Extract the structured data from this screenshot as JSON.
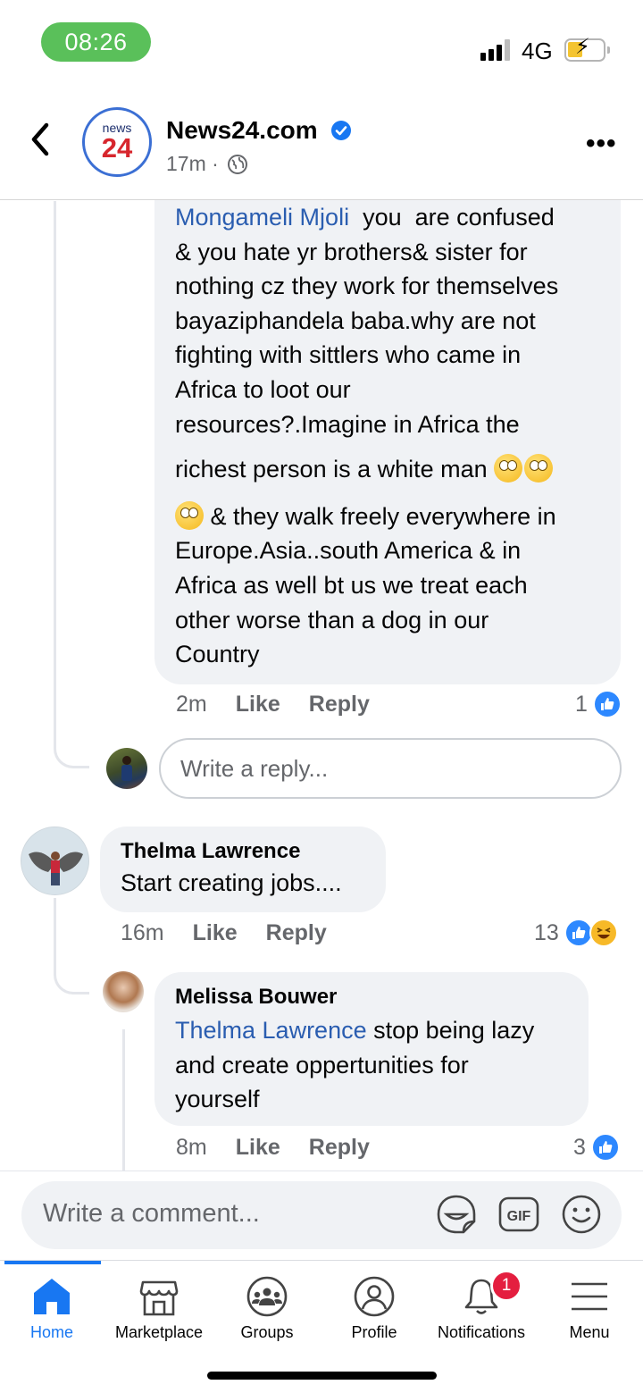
{
  "status_bar": {
    "time": "08:26",
    "network": "4G"
  },
  "post_header": {
    "logo_top": "news",
    "logo_bottom": "24",
    "page_name": "News24.com",
    "time": "17m ·"
  },
  "comments": {
    "reply1": {
      "mention": "Mongameli Mjoli",
      "lines": [
        "  you  are confused",
        "& you hate yr brothers& sister for",
        "nothing cz they work for themselves",
        "bayaziphandela baba.why are not",
        "fighting with sittlers who came in",
        "Africa to loot our",
        "resources?.Imagine in Africa the",
        "richest person is a white man",
        " & they walk freely everywhere in",
        "Europe.Asia..south America & in",
        "Africa as well bt us we treat each",
        "other worse than a dog in our",
        "Country"
      ],
      "time": "2m",
      "like": "Like",
      "reply": "Reply",
      "reaction_count": "1"
    },
    "reply_input_placeholder": "Write a reply...",
    "comment2": {
      "author": "Thelma Lawrence",
      "text": "Start creating jobs....",
      "time": "16m",
      "like": "Like",
      "reply": "Reply",
      "reaction_count": "13"
    },
    "reply2": {
      "author": "Melissa Bouwer",
      "mention": "Thelma Lawrence",
      "text_line1": " stop being lazy",
      "text_line2": "and create oppertunities for",
      "text_line3": "yourself",
      "time": "8m",
      "like": "Like",
      "reply": "Reply",
      "reaction_count": "3"
    }
  },
  "composer": {
    "placeholder": "Write a comment..."
  },
  "tabs": {
    "home": "Home",
    "marketplace": "Marketplace",
    "groups": "Groups",
    "profile": "Profile",
    "notifications": "Notifications",
    "notifications_badge": "1",
    "menu": "Menu"
  },
  "colors": {
    "accent": "#1877f2",
    "mention": "#2a5db0",
    "bubble": "#f0f2f5",
    "status_pill": "#5ac05a",
    "badge": "#e41e3f"
  }
}
